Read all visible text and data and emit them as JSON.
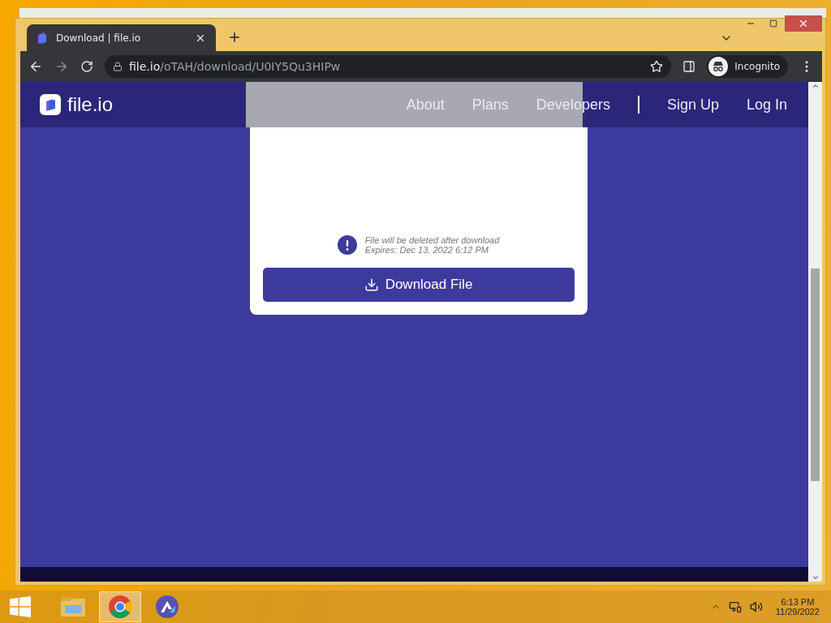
{
  "browser": {
    "tab": {
      "title": "Download | file.io",
      "selected": true
    },
    "address": {
      "domain": "file.io",
      "path": "/oTAH/download/U0IY5Qu3HIPw"
    },
    "profile": "Incognito"
  },
  "site": {
    "logo": "file.io",
    "nav": [
      "About",
      "Plans",
      "Developers"
    ],
    "auth": [
      "Sign Up",
      "Log In"
    ]
  },
  "card": {
    "notices": [
      "File will be deleted after download",
      "Expires: Dec 13, 2022 6:12 PM"
    ],
    "button": "Download File"
  },
  "taskbar": {
    "apps": [
      {
        "kind": "explorer",
        "selected": false
      },
      {
        "kind": "chrome",
        "selected": true
      },
      {
        "kind": "app",
        "selected": false
      }
    ],
    "time": "6:13 PM",
    "date": "11/29/2022"
  }
}
